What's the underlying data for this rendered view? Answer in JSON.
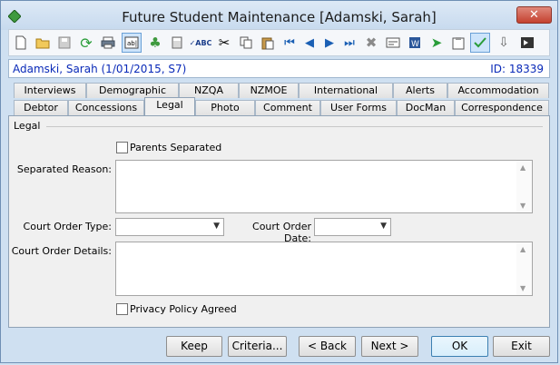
{
  "window": {
    "title": "Future Student Maintenance  [Adamski, Sarah]",
    "close_label": "✕"
  },
  "student": {
    "name": "Adamski, Sarah (1/01/2015, S7)",
    "id": "ID: 18339"
  },
  "tabs_row1": [
    "Interviews",
    "Demographic",
    "NZQA",
    "NZMOE",
    "International",
    "Alerts",
    "Accommodation"
  ],
  "tabs_row2": [
    "Debtor",
    "Concessions",
    "Legal",
    "Photo",
    "Comment",
    "User Forms",
    "DocMan",
    "Correspondence"
  ],
  "active_tab": "Legal",
  "legal": {
    "group_title": "Legal",
    "parents_separated_label": "Parents Separated",
    "separated_reason_label": "Separated Reason:",
    "court_order_type_label": "Court Order Type:",
    "court_order_date_label": "Court Order Date:",
    "court_order_details_label": "Court Order Details:",
    "privacy_policy_label": "Privacy Policy Agreed"
  },
  "buttons": {
    "keep": "Keep",
    "criteria": "Criteria...",
    "back": "< Back",
    "next": "Next >",
    "ok": "OK",
    "exit": "Exit"
  },
  "toolbar_icons": [
    "new-icon",
    "open-icon",
    "save-icon",
    "refresh-icon",
    "print-icon",
    "text-field-icon",
    "tree-icon",
    "calculator-icon",
    "spellcheck-icon",
    "cut-icon",
    "copy-icon",
    "paste-icon",
    "first-record-icon",
    "prev-record-icon",
    "next-record-icon",
    "last-record-icon",
    "delete-icon",
    "mail-icon",
    "word-icon",
    "send-icon",
    "clipboard-icon",
    "approve-icon",
    "download-icon",
    "present-icon"
  ]
}
